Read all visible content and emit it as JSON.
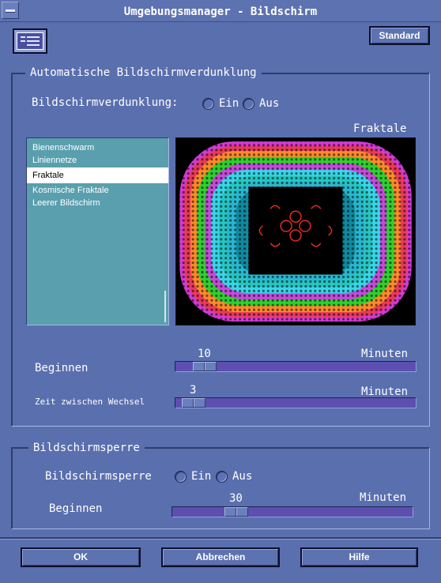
{
  "window": {
    "title": "Umgebungsmanager - Bildschirm"
  },
  "header": {
    "standard_button": "Standard",
    "app_icon": "screen-settings-icon"
  },
  "screensaver": {
    "legend": "Automatische Bildschirmverdunklung",
    "toggle_label": "Bildschirmverdunklung:",
    "on_label": "Ein",
    "off_label": "Aus",
    "preview_label": "Fraktale",
    "list": [
      "Bienenschwarm",
      "Liniennetze",
      "Fraktale",
      "Kosmische Fraktale",
      "Leerer Bildschirm"
    ],
    "selected": "Fraktale",
    "start": {
      "label": "Beginnen",
      "value": "10",
      "unit": "Minuten"
    },
    "interval": {
      "label": "Zeit zwischen Wechsel",
      "value": "3",
      "unit": "Minuten"
    }
  },
  "lock": {
    "legend": "Bildschirmsperre",
    "toggle_label": "Bildschirmsperre",
    "on_label": "Ein",
    "off_label": "Aus",
    "start": {
      "label": "Beginnen",
      "value": "30",
      "unit": "Minuten"
    }
  },
  "footer": {
    "ok": "OK",
    "cancel": "Abbrechen",
    "help": "Hilfe"
  }
}
